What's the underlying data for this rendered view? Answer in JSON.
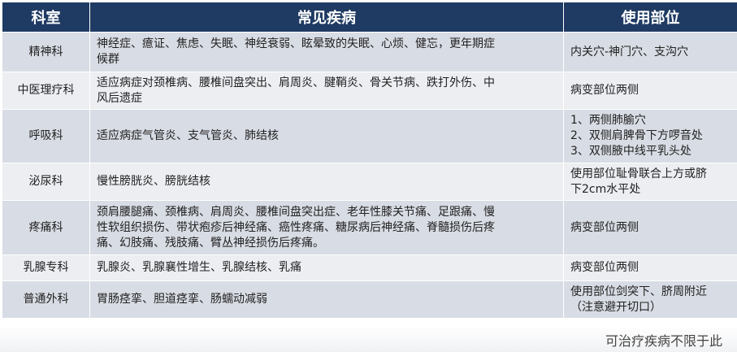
{
  "table": {
    "headers": [
      "科室",
      "常见疾病",
      "使用部位"
    ],
    "rows": [
      {
        "dept": "精神科",
        "disease": [
          "神经症、癔证、焦虑、失眠、神经衰弱、眩晕致的失眠、心烦、健忘，更年期症",
          "候群"
        ],
        "site": [
          "内关穴-神门穴、支沟穴"
        ]
      },
      {
        "dept": "中医理疗科",
        "disease": [
          "适应病症对颈椎病、腰椎间盘突出、肩周炎、腱鞘炎、骨关节病、跌打外伤、中",
          "风后遗症"
        ],
        "site": [
          "病变部位两侧"
        ]
      },
      {
        "dept": "呼吸科",
        "disease": [
          "适应病症气管炎、支气管炎、肺结核"
        ],
        "site": [
          "1、两侧肺腧穴",
          "2、双侧肩脾骨下方啰音处",
          "3、双侧腋中线平乳头处"
        ]
      },
      {
        "dept": "泌尿科",
        "disease": [
          "慢性膀胱炎、膀胱结核"
        ],
        "site": [
          "使用部位耻骨联合上方或脐",
          "下2cm水平处"
        ]
      },
      {
        "dept": "疼痛科",
        "disease": [
          "颈肩腰腿痛、颈椎病、肩周炎、腰椎间盘突出症、老年性膝关节痛、足跟痛、慢",
          "性软组织损伤、带状疱疹后神经痛、癌性疼痛、糖尿病后神经痛、脊髓损伤后疼",
          "痛、幻肢痛、残肢痛、臂丛神经损伤后疼痛。"
        ],
        "site": [
          "病变部位两侧"
        ]
      },
      {
        "dept": "乳腺专科",
        "disease": [
          "乳腺炎、乳腺襄性增生、乳腺结核、乳痛"
        ],
        "site": [
          "病变部位两侧"
        ]
      },
      {
        "dept": "普通外科",
        "disease": [
          "胃肠痉挛、胆道痉挛、肠蠕动减弱"
        ],
        "site": [
          "使用部位剑突下、脐周附近",
          "（注意避开切口）"
        ]
      }
    ]
  },
  "footnote": "可治疗疾病不限于此"
}
